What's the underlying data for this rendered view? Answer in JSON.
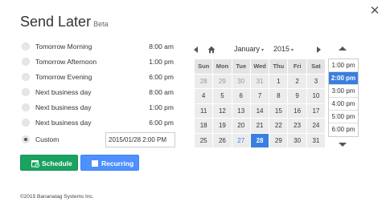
{
  "dialog": {
    "title": "Send Later",
    "badge": "Beta",
    "close_glyph": "✕"
  },
  "options": [
    {
      "label": "Tomorrow Morning",
      "time": "8:00 am",
      "selected": false
    },
    {
      "label": "Tomorrow Afternoon",
      "time": "1:00 pm",
      "selected": false
    },
    {
      "label": "Tomorrow Evening",
      "time": "6:00 pm",
      "selected": false
    },
    {
      "label": "Next business day",
      "time": "8:00 am",
      "selected": false
    },
    {
      "label": "Next business day",
      "time": "1:00 pm",
      "selected": false
    },
    {
      "label": "Next business day",
      "time": "6:00 pm",
      "selected": false
    }
  ],
  "custom": {
    "label": "Custom",
    "value": "2015/01/28 2:00 PM",
    "selected": true
  },
  "buttons": {
    "schedule": "Schedule",
    "recurring": "Recurring"
  },
  "calendar": {
    "month": "January",
    "year": "2015",
    "weekdays": [
      "Sun",
      "Mon",
      "Tue",
      "Wed",
      "Thu",
      "Fri",
      "Sat"
    ],
    "weeks": [
      [
        "28",
        "29",
        "30",
        "31",
        "1",
        "2",
        "3"
      ],
      [
        "4",
        "5",
        "6",
        "7",
        "8",
        "9",
        "10"
      ],
      [
        "11",
        "12",
        "13",
        "14",
        "15",
        "16",
        "17"
      ],
      [
        "18",
        "19",
        "20",
        "21",
        "22",
        "23",
        "24"
      ],
      [
        "25",
        "26",
        "27",
        "28",
        "29",
        "30",
        "31"
      ]
    ],
    "today": "27",
    "selected": "28"
  },
  "times": {
    "items": [
      "1:00 pm",
      "2:00 pm",
      "3:00 pm",
      "4:00 pm",
      "5:00 pm",
      "6:00 pm"
    ],
    "selected": "2:00 pm"
  },
  "footer": "©2015 Bananatag Systems Inc.",
  "colors": {
    "schedule": "#1aa260",
    "recurring": "#4d90fe",
    "selected": "#3a7fe0"
  }
}
